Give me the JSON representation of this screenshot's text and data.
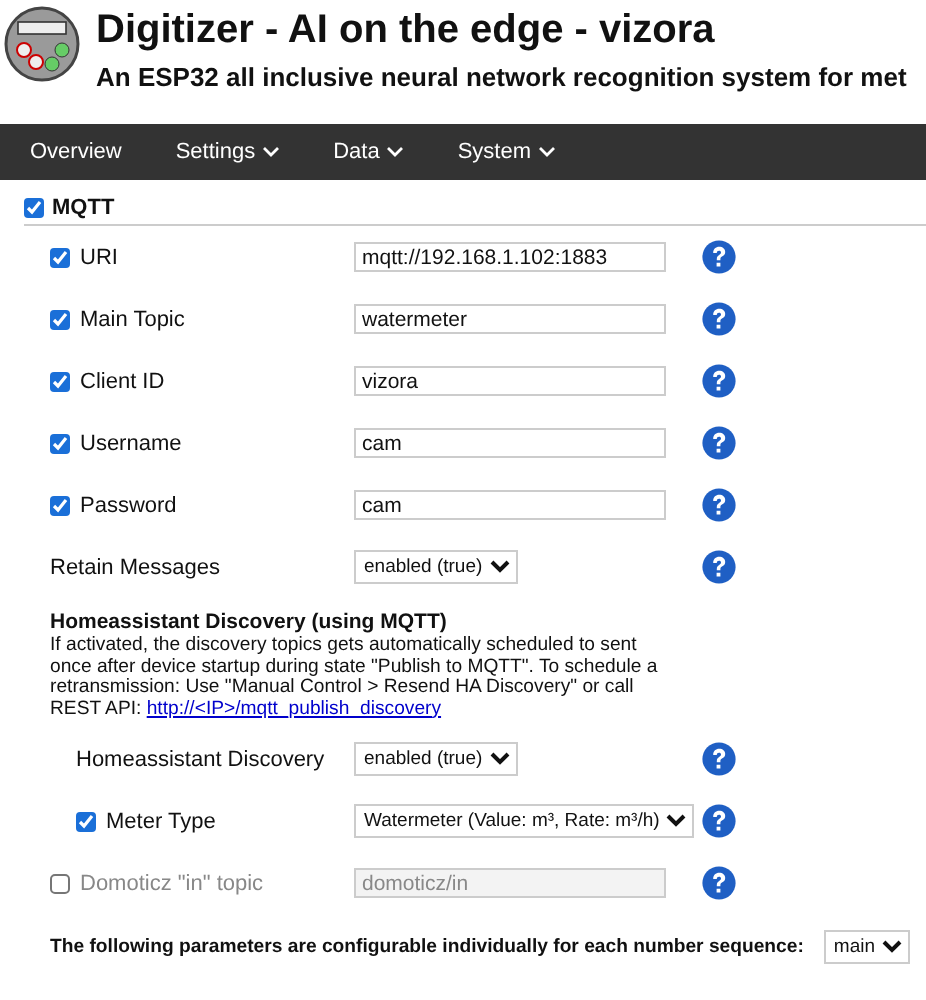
{
  "header": {
    "title": "Digitizer - AI on the edge - vizora",
    "subtitle": "An ESP32 all inclusive neural network recognition system for met"
  },
  "nav": [
    {
      "label": "Overview",
      "dropdown": false
    },
    {
      "label": "Settings",
      "dropdown": true
    },
    {
      "label": "Data",
      "dropdown": true
    },
    {
      "label": "System",
      "dropdown": true
    }
  ],
  "mqtt": {
    "label": "MQTT",
    "checked": true,
    "rows": [
      {
        "kind": "text",
        "label": "URI",
        "checked": true,
        "value": "mqtt://192.168.1.102:1883"
      },
      {
        "kind": "text",
        "label": "Main Topic",
        "checked": true,
        "value": "watermeter"
      },
      {
        "kind": "text",
        "label": "Client ID",
        "checked": true,
        "value": "vizora"
      },
      {
        "kind": "text",
        "label": "Username",
        "checked": true,
        "value": "cam"
      },
      {
        "kind": "text",
        "label": "Password",
        "checked": true,
        "value": "cam"
      },
      {
        "kind": "select",
        "label": "Retain Messages",
        "value": "enabled (true)"
      }
    ],
    "discovery": {
      "heading": "Homeassistant Discovery (using MQTT)",
      "text": "If activated, the discovery topics gets automatically scheduled to sent once after device startup during state \"Publish to MQTT\". To schedule a retransmission: Use \"Manual Control > Resend HA Discovery\" or call REST API: ",
      "link": "http://<IP>/mqtt_publish_discovery",
      "rows": [
        {
          "kind": "select",
          "label": "Homeassistant Discovery",
          "value": "enabled (true)"
        },
        {
          "kind": "select",
          "label": "Meter Type",
          "checked": true,
          "value": "Watermeter (Value: m³, Rate: m³/h)"
        }
      ]
    },
    "more_rows": [
      {
        "kind": "text",
        "label": "Domoticz \"in\" topic",
        "checked": false,
        "placeholder": "domoticz/in"
      }
    ]
  },
  "sequence": {
    "label": "The following parameters are configurable individually for each number sequence:",
    "value": "main"
  }
}
